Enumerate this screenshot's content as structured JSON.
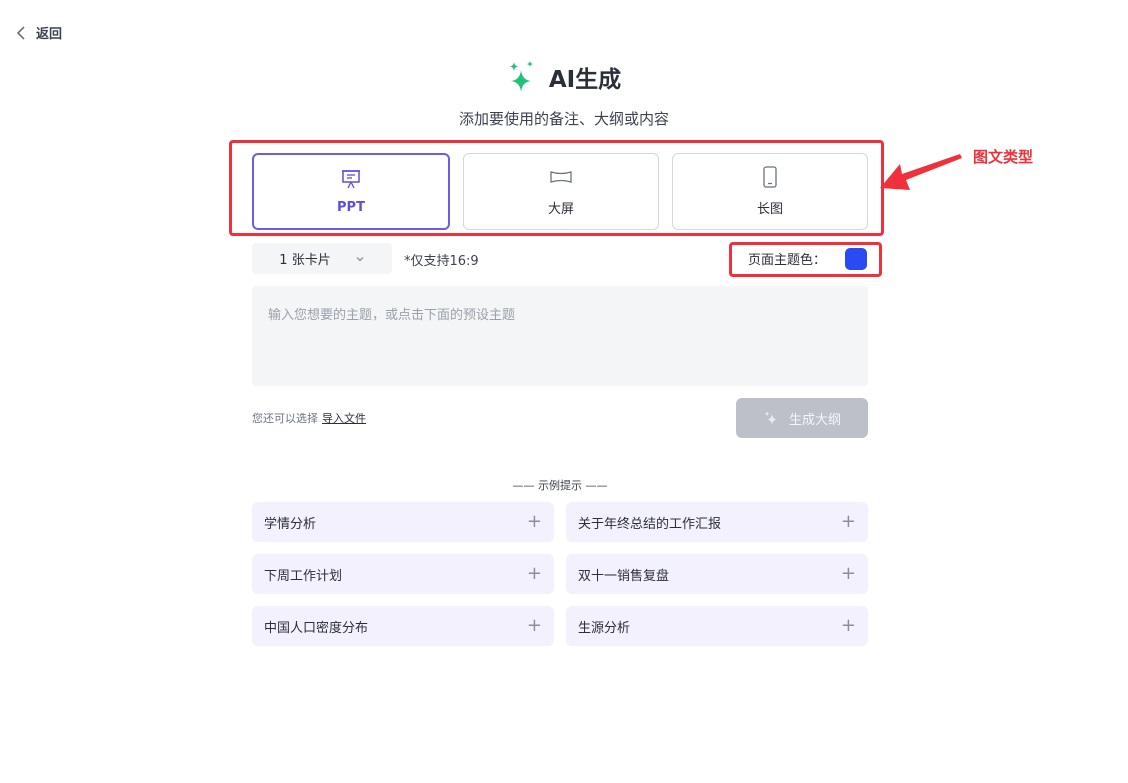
{
  "header": {
    "back_label": "返回"
  },
  "title": "AI生成",
  "subtitle": "添加要使用的备注、大纲或内容",
  "types": [
    {
      "label": "PPT",
      "icon": "presentation-icon",
      "active": true
    },
    {
      "label": "大屏",
      "icon": "widescreen-icon",
      "active": false
    },
    {
      "label": "长图",
      "icon": "phone-icon",
      "active": false
    }
  ],
  "annotation": {
    "label": "图文类型",
    "color": "#f0303a"
  },
  "options": {
    "card_count": "1 张卡片",
    "ratio_note": "*仅支持16:9",
    "theme_label": "页面主题色：",
    "theme_color": "#2b4bf2"
  },
  "input": {
    "placeholder": "输入您想要的主题，或点击下面的预设主题",
    "value": ""
  },
  "import": {
    "prefix": "您还可以选择",
    "link": "导入文件"
  },
  "generate_button": "生成大纲",
  "examples_title": "—— 示例提示 ——",
  "examples": [
    "学情分析",
    "关于年终总结的工作汇报",
    "下周工作计划",
    "双十一销售复盘",
    "中国人口密度分布",
    "生源分析"
  ],
  "colors": {
    "accent": "#6c5ce7",
    "sparkle": "#1ec27a",
    "highlight": "#f0303a"
  }
}
